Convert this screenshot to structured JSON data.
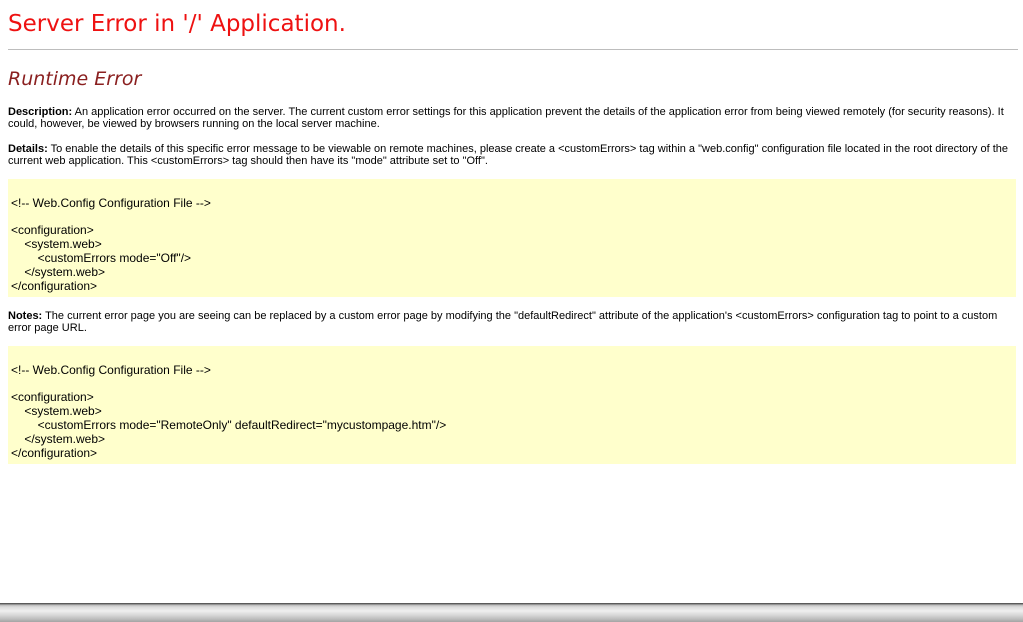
{
  "page": {
    "title": "Server Error in '/' Application.",
    "subtitle": "Runtime Error",
    "description": {
      "label": "Description:",
      "text": " An application error occurred on the server. The current custom error settings for this application prevent the details of the application error from being viewed remotely (for security reasons). It could, however, be viewed by browsers running on the local server machine."
    },
    "details": {
      "label": "Details:",
      "text": " To enable the details of this specific error message to be viewable on remote machines, please create a <customErrors> tag within a \"web.config\" configuration file located in the root directory of the current web application. This <customErrors> tag should then have its \"mode\" attribute set to \"Off\"."
    },
    "code1": {
      "lines": [
        "<!-- Web.Config Configuration File -->",
        "<configuration>",
        "    <system.web>",
        "        <customErrors mode=\"Off\"/>",
        "    </system.web>",
        "</configuration>"
      ]
    },
    "notes": {
      "label": "Notes:",
      "text": " The current error page you are seeing can be replaced by a custom error page by modifying the \"defaultRedirect\" attribute of the application's <customErrors> configuration tag to point to a custom error page URL."
    },
    "code2": {
      "lines": [
        "<!-- Web.Config Configuration File -->",
        "<configuration>",
        "    <system.web>",
        "        <customErrors mode=\"RemoteOnly\" defaultRedirect=\"mycustompage.htm\"/>",
        "    </system.web>",
        "</configuration>"
      ]
    }
  }
}
